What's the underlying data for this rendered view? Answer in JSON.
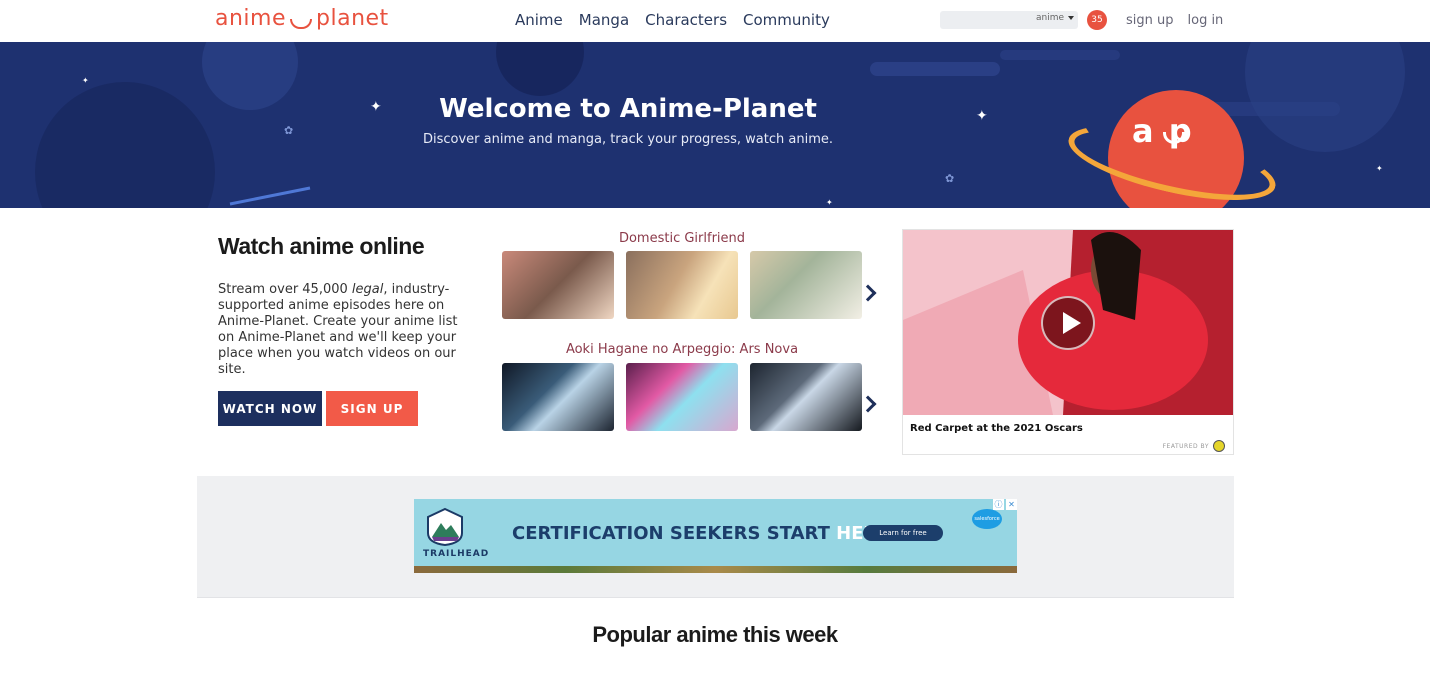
{
  "header": {
    "logo_left": "anime",
    "logo_right": "planet",
    "nav": [
      "Anime",
      "Manga",
      "Characters",
      "Community"
    ],
    "search": {
      "value": "",
      "select": "anime"
    },
    "notification_count": "35",
    "signup": "sign up",
    "login": "log in"
  },
  "hero": {
    "title": "Welcome to Anime-Planet",
    "subtitle": "Discover anime and manga, track your progress, watch anime.",
    "planet_text": "a p"
  },
  "watch": {
    "title": "Watch anime online",
    "desc_pre": "Stream over 45,000 ",
    "desc_em": "legal",
    "desc_post": ", industry-supported anime episodes here on Anime-Planet. Create your anime list on Anime-Planet and we'll keep your place when you watch videos on our site.",
    "watch_btn": "WATCH NOW",
    "signup_btn": "SIGN UP"
  },
  "shows": [
    {
      "title": "Domestic Girlfriend"
    },
    {
      "title": "Aoki Hagane no Arpeggio: Ars Nova"
    }
  ],
  "video": {
    "caption": "Red Carpet at the 2021 Oscars",
    "featured": "FEATURED BY"
  },
  "ad": {
    "brand": "TRAILHEAD",
    "text": "CERTIFICATION SEEKERS START ",
    "highlight": "HERE.",
    "cta": "Learn for free",
    "sponsor": "salesforce"
  },
  "popular_title": "Popular anime this week",
  "colors": {
    "brand": "#e8523f",
    "hero_bg": "#1e3170",
    "navy": "#1d2f5e"
  }
}
